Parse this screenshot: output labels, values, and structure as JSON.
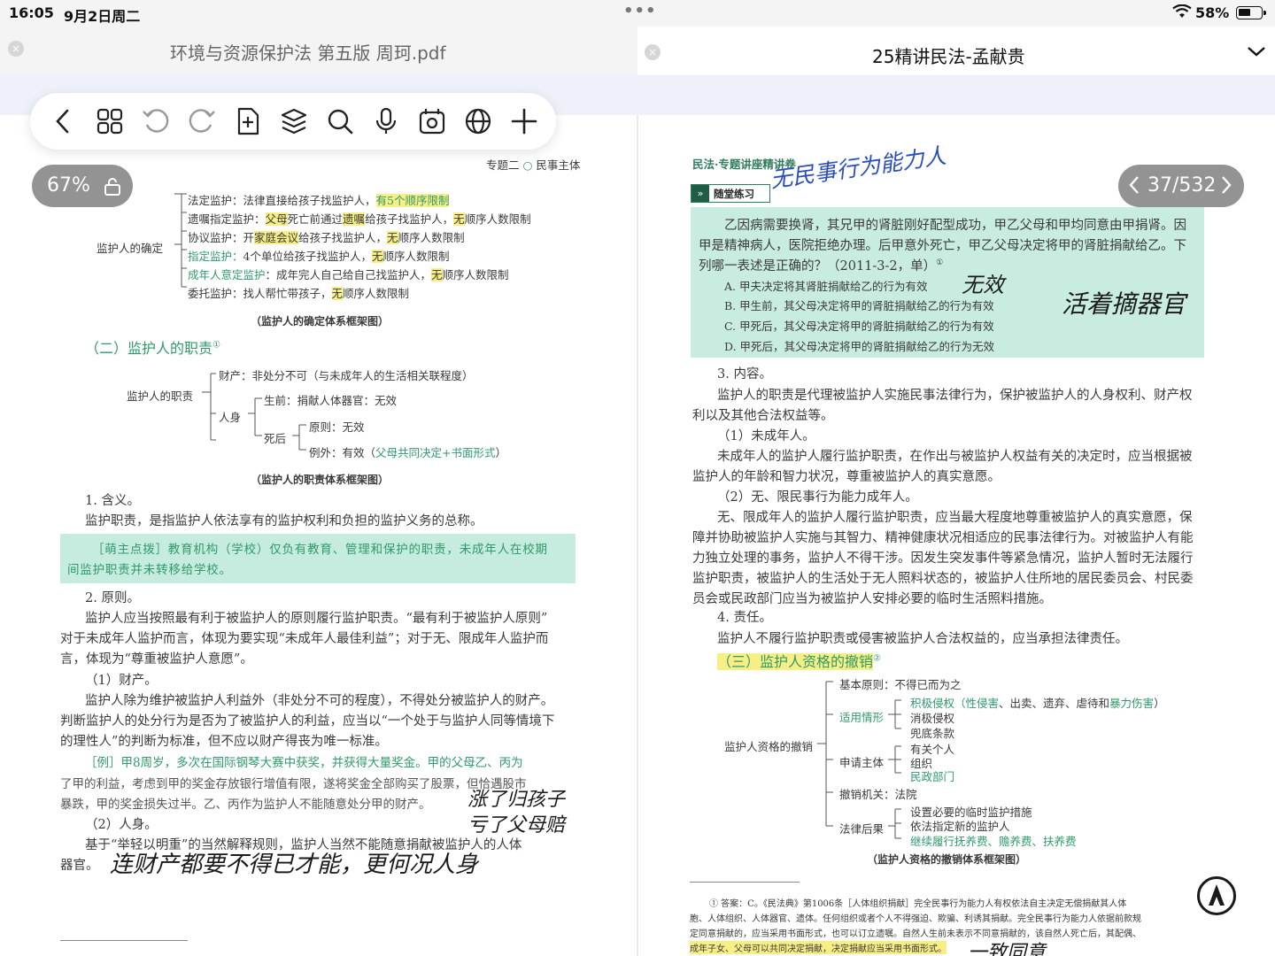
{
  "status": {
    "time": "16:05",
    "date": "9月2日周二",
    "dots": "•••",
    "battery": "58%",
    "battery_level": 0.58
  },
  "tabs": {
    "left": {
      "title": "环境与资源保护法 第五版 周珂.pdf",
      "close": "×"
    },
    "right": {
      "title": "25精讲民法-孟献贵",
      "close": "×"
    }
  },
  "toolbar": {
    "buttons": [
      "back-icon",
      "grid-icon",
      "undo-icon",
      "redo-icon",
      "add-page-icon",
      "layers-icon",
      "search-icon",
      "microphone-icon",
      "record-icon",
      "translate-icon",
      "add-icon"
    ]
  },
  "left_viewer": {
    "zoom": "67%"
  },
  "right_viewer": {
    "page_indicator": "37/532"
  },
  "left_page": {
    "header_right": "专题二",
    "header_right2": "民事主体",
    "d1": {
      "root": "监护人的确定",
      "items": [
        {
          "a": "法定监护：法律直接给孩子找监护人，",
          "b": "有5个顺序限制"
        },
        {
          "a": "遗嘱指定监护：",
          "a2": "父母",
          "a3": "死亡前通过",
          "a4": "遗嘱",
          "a5": "给孩子找监护人，",
          "b": "无",
          "c": "顺序人数限制"
        },
        {
          "a": "协议监护：开",
          "a2": "家庭会议",
          "a3": "给孩子找监护人，",
          "b": "无",
          "c": "顺序人数限制"
        },
        {
          "a": "指定监护：",
          "a2": "4个单位",
          "a3": "给孩子找监护人，",
          "b": "无",
          "c": "顺序人数限制"
        },
        {
          "a": "成年人意定监护",
          "a2": "：成年完人自己给自己找监护人，",
          "b": "无",
          "c": "顺序人数限制"
        },
        {
          "a": "委托监护：找人帮忙带孩子，",
          "b": "无",
          "c": "顺序人数限制"
        }
      ],
      "caption": "（监护人的确定体系框架图）"
    },
    "sec2_heading": "（二）监护人的职责",
    "sec2_sup": "①",
    "d2": {
      "root": "监护人的职责",
      "property": "财产：非处分不可（与未成年人的生活相关联程度）",
      "person": "人身",
      "alive": "生前：捐献人体器官：无效",
      "dead": "死后",
      "rule": "原则：无效",
      "exception_a": "例外：有效（",
      "exception_b": "父母共同决定+书面形式",
      "exception_c": "）",
      "caption": "（监护人的职责体系框架图）"
    },
    "p1": "1. 含义。",
    "p2": "监护职责，是指监护人依法享有的监护权利和负担的监护义务的总称。",
    "tip1": "［萌主点拨］教育机构（学校）仅负有教育、管理和保护的职责，未成年人在校期",
    "tip2": "间监护职责并未转移给学校。",
    "p3": "2. 原则。",
    "p4": "监护人应当按照最有利于被监护人的原则履行监护职责。“最有利于被监护人原则”",
    "p5": "对于未成年人监护而言，体现为要实现“未成年人最佳利益”；对于无、限成年人监护而",
    "p6": "言，体现为“尊重被监护人意愿”。",
    "p7": "（1）财产。",
    "p8": "监护人除为维护被监护人利益外（非处分不可的程度），不得处分被监护人的财产。",
    "p9": "判断监护人的处分行为是否为了被监护人的利益，应当以“一个处于与监护人同等情境下",
    "p10": "的理性人”的判断为标准，但不应以财产得丧为唯一标准。",
    "p11": "［例］甲8周岁，多次在国际钢琴大赛中获奖，并获得大量奖金。甲的父母乙、丙为",
    "p12": "了甲的利益，考虑到甲的奖金存放银行增值有限，遂将奖金全部购买了股票，但恰遇股市",
    "p13": "暴跌，甲的奖金损失过半。乙、丙作为监护人不能随意处分甲的财产。",
    "p14": "（2）人身。",
    "p15": "基于“举轻以明重”的当然解释规则，监护人当然不能随意捐献被监护人的人体",
    "p16": "器官。",
    "hand1": "涨了归孩子",
    "hand2": "亏了父母赔",
    "hand3": "连财产都要不得已才能，更何况人身"
  },
  "right_page": {
    "header": "民法·专题讲座精讲卷",
    "practice_label": "随堂练习",
    "hand_top": "无民事行为能力人",
    "q1": "乙因病需要换肾，其兄甲的肾脏刚好配型成功，甲乙父母和甲均同意由甲捐肾。因",
    "q2": "甲是精神病人，医院拒绝办理。后甲意外死亡，甲乙父母决定将甲的肾脏捐献给乙。下",
    "q3": "列哪一表述是正确的？（2011-3-2，单）",
    "q3_sup": "①",
    "optA": "A. 甲夫决定将其肾脏捐献给乙的行为有效",
    "optB": "B. 甲生前，其父母决定将甲的肾脏捐献给乙的行为有效",
    "optC": "C. 甲死后，其父母决定将甲的肾脏捐献给乙的行为有效",
    "optD": "D. 甲死后，其父母决定将甲的肾脏捐献给乙的行为无效",
    "hand_a": "无效",
    "hand_b": "活着摘器官",
    "s3": "3. 内容。",
    "r1": "监护人的职责是代理被监护人实施民事法律行为，保护被监护人的人身权利、财产权",
    "r2": "利以及其他合法权益等。",
    "r3": "（1）未成年人。",
    "r4": "未成年人的监护人履行监护职责，在作出与被监护人权益有关的决定时，应当根据被",
    "r5": "监护人的年龄和智力状况，尊重被监护人的真实意愿。",
    "r6": "（2）无、限民事行为能力成年人。",
    "r7": "无、限成年人的监护人履行监护职责，应当最大程度地尊重被监护人的真实意愿，保",
    "r8": "障并协助被监护人实施与其智力、精神健康状况相适应的民事法律行为。对被监护人有能",
    "r9": "力独立处理的事务，监护人不得干涉。因发生突发事件等紧急情况，监护人暂时无法履行",
    "r10": "监护职责，被监护人的生活处于无人照料状态的，被监护人住所地的居民委员会、村民委",
    "r11": "员会或民政部门应当为被监护人安排必要的临时生活照料措施。",
    "s4": "4. 责任。",
    "r12": "监护人不履行监护职责或侵害被监护人合法权益的，应当承担法律责任。",
    "sec3": "（三）监护人资格的撤销",
    "sec3_sup": "②",
    "d3": {
      "root": "监护人资格的撤销",
      "basic": "基本原则：不得已而为之",
      "cases": "适用情形",
      "c1a": "积极侵权（",
      "c1b": "性侵害",
      "c1c": "、出卖、遗弃、虐待和",
      "c1d": "暴力伤害",
      "c1e": "）",
      "c2": "消极侵权",
      "c3": "兜底条款",
      "applicant": "申请主体",
      "a1": "有关个人",
      "a2": "组织",
      "a3": "民政部门",
      "court": "撤销机关：法院",
      "effect": "法律后果",
      "e1": "设置必要的临时监护措施",
      "e2": "依法指定新的监护人",
      "e3": "继续履行抚养费、赡养费、扶养费",
      "caption": "（监护人资格的撤销体系框架图）"
    },
    "fn1": "①  答案：C。《民法典》第1006条［人体组织捐献］完全民事行为能力人有权依法自主决定无偿捐献其人体",
    "fn2": "胞、人体组织、人体器官、遗体。任何组织或者个人不得强迫、欺骗、利诱其捐献。完全民事行为能力人依据前款规",
    "fn3": "定同意捐献的，应当采用书面形式，也可以订立遗嘱。自然人生前未表示不同意捐献的，该自然人死亡后，其配偶、",
    "fn4": "成年子女、父母可以共同决定捐献，决定捐献应当采用书面形式。",
    "hand_bottom": "一致同意"
  }
}
